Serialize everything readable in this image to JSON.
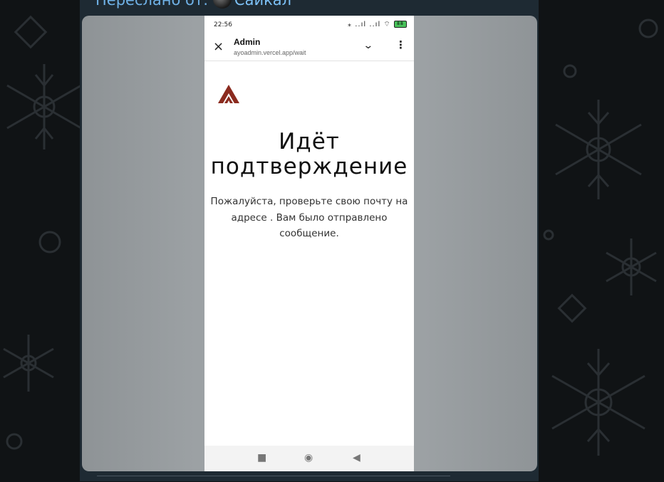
{
  "forward": {
    "prefix": "Переслано от:",
    "sender": "Сайкал"
  },
  "phone": {
    "status": {
      "time": "22:56",
      "icons": "⁎ ..ıl ..ıl ⌔",
      "battery": "88"
    },
    "browser": {
      "title": "Admin",
      "url": "ayoadmin.vercel.app/wait",
      "close_icon": "×",
      "chevron_icon": "⌄",
      "menu_icon": "⋮"
    },
    "page": {
      "heading_line1": "Идёт",
      "heading_line2": "подтверждение",
      "message": "Пожалуйста, проверьте свою почту на адресе . Вам было отправлено сообщение.",
      "logo_color": "#8b2b1f"
    },
    "nav": {
      "recents_icon": "■",
      "home_icon": "◉",
      "back_icon": "◀"
    }
  }
}
